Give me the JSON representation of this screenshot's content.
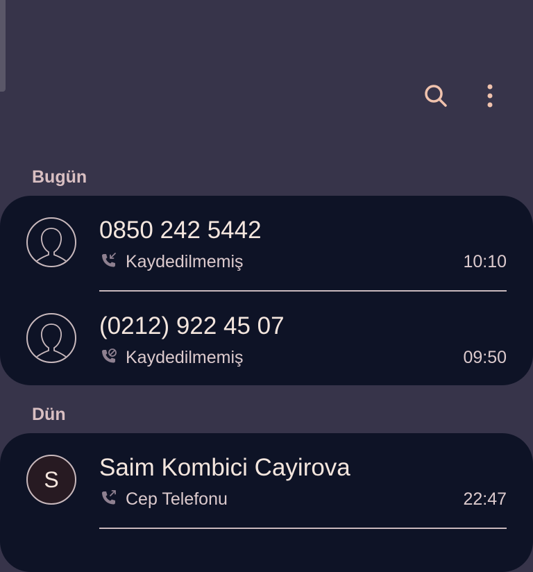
{
  "toolbar": {
    "search_icon": "search-icon",
    "more_icon": "more-vertical-icon"
  },
  "colors": {
    "background": "#37344a",
    "card": "#0e1326",
    "accent": "#f0c2ad",
    "text": "#f4e6de"
  },
  "sections": [
    {
      "header": "Bugün",
      "calls": [
        {
          "name": "0850 242 5442",
          "type_label": "Kaydedilmemiş",
          "time": "10:10",
          "call_icon": "missed-call-icon",
          "avatar": "person-silhouette"
        },
        {
          "name": "(0212) 922 45 07",
          "type_label": "Kaydedilmemiş",
          "time": "09:50",
          "call_icon": "rejected-call-icon",
          "avatar": "person-silhouette"
        }
      ]
    },
    {
      "header": "Dün",
      "calls": [
        {
          "name": "Saim Kombici Cayirova",
          "type_label": "Cep Telefonu",
          "time": "22:47",
          "call_icon": "outgoing-call-icon",
          "avatar_letter": "S"
        }
      ]
    }
  ]
}
